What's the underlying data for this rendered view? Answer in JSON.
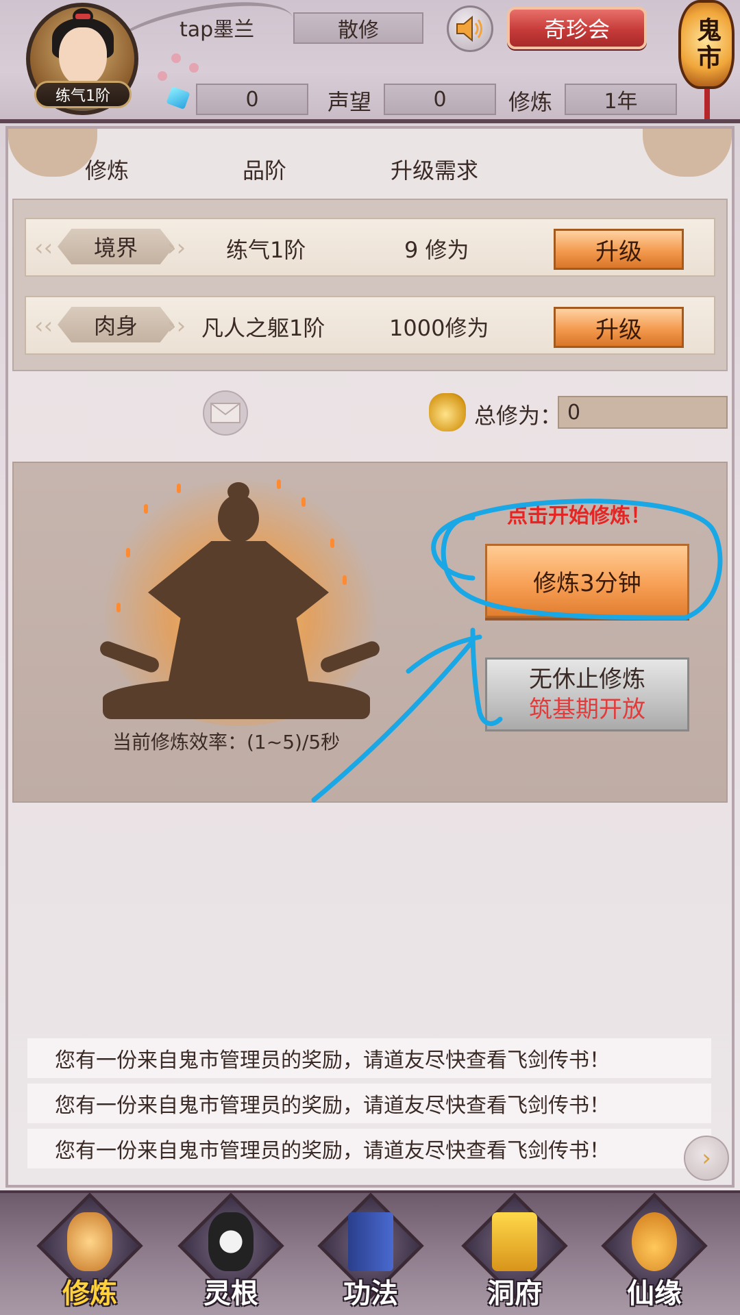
{
  "header": {
    "player_name": "tap墨兰",
    "sect": "散修",
    "realm_badge": "练气1阶",
    "gems": "0",
    "reputation_label": "声望",
    "reputation": "0",
    "cultivation_label": "修炼",
    "cultivation_years": "1年",
    "treasure_button": "奇珍会",
    "ghost_market": "鬼市",
    "sound_icon": "speaker-icon"
  },
  "table": {
    "headers": [
      "修炼",
      "品阶",
      "升级需求"
    ],
    "rows": [
      {
        "tag": "境界",
        "grade": "练气1阶",
        "requirement": "9 修为",
        "button": "升级"
      },
      {
        "tag": "肉身",
        "grade": "凡人之躯1阶",
        "requirement": "1000修为",
        "button": "升级"
      }
    ]
  },
  "total": {
    "label": "总修为：",
    "value": "0"
  },
  "meditation": {
    "hint": "点击开始修炼！",
    "rate": "当前修炼效率：(1~5)/5秒",
    "train_button": "修炼3分钟",
    "endless_line1": "无休止修炼",
    "endless_line2": "筑基期开放"
  },
  "messages": [
    "您有一份来自鬼市管理员的奖励，请道友尽快查看飞剑传书！",
    "您有一份来自鬼市管理员的奖励，请道友尽快查看飞剑传书！",
    "您有一份来自鬼市管理员的奖励，请道友尽快查看飞剑传书！"
  ],
  "nav": [
    {
      "label": "修炼",
      "active": true
    },
    {
      "label": "灵根",
      "active": false
    },
    {
      "label": "功法",
      "active": false
    },
    {
      "label": "洞府",
      "active": false
    },
    {
      "label": "仙缘",
      "active": false
    }
  ],
  "colors": {
    "accent_orange": "#f39a4e",
    "hint_red": "#e52424",
    "annotation_blue": "#1aa7e6",
    "active_nav": "#ffd23c"
  }
}
